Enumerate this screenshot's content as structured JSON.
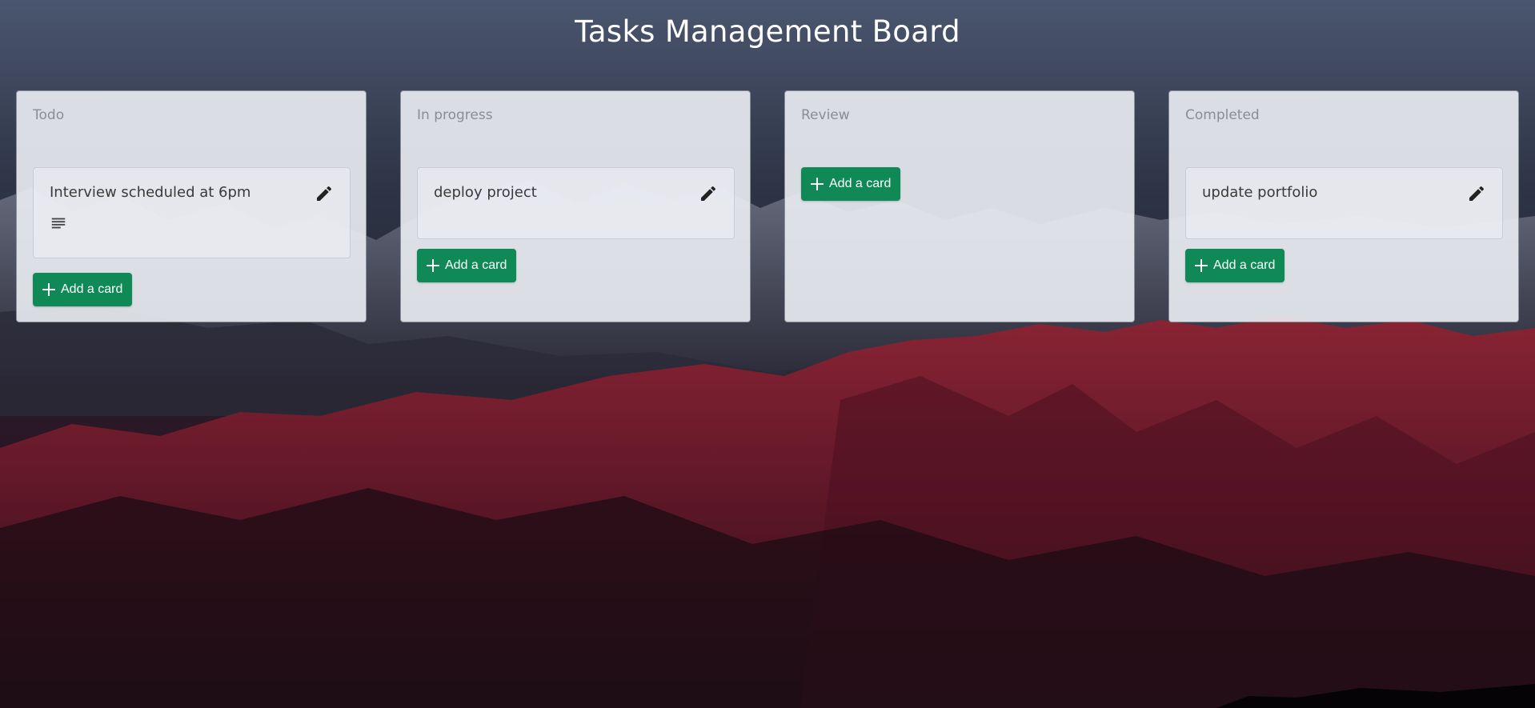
{
  "page": {
    "title": "Tasks Management Board",
    "accent_color": "#0f8a57",
    "background": "mountain landscape at dusk"
  },
  "lists": [
    {
      "title": "Todo",
      "cards": [
        {
          "text": "Interview scheduled at 6pm",
          "has_description": true
        }
      ],
      "add_label": "Add a card"
    },
    {
      "title": "In progress",
      "cards": [
        {
          "text": "deploy project",
          "has_description": false
        }
      ],
      "add_label": "Add a card"
    },
    {
      "title": "Review",
      "cards": [],
      "add_label": "Add a card"
    },
    {
      "title": "Completed",
      "cards": [
        {
          "text": "update portfolio",
          "has_description": false
        }
      ],
      "add_label": "Add a card"
    }
  ],
  "icons": {
    "edit": "pencil-icon",
    "description": "description-lines-icon",
    "add": "plus-icon"
  }
}
